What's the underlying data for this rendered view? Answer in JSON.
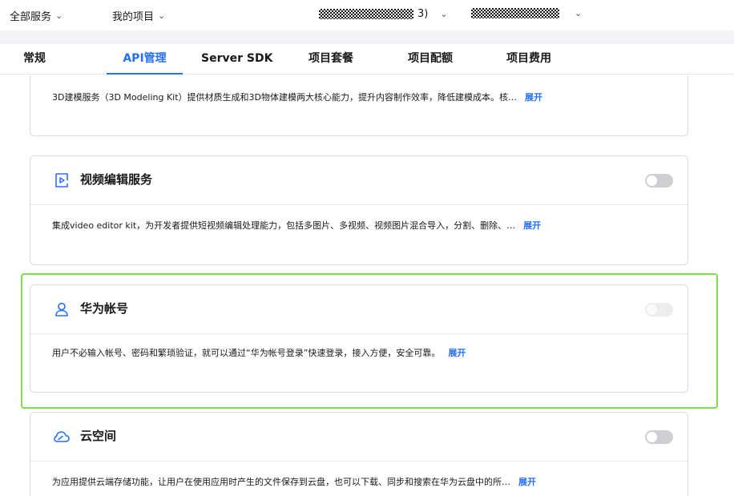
{
  "topbar": {
    "all_services": "全部服务",
    "my_projects": "我的项目",
    "project_suffix": "3)"
  },
  "tabs": [
    {
      "label": "常规"
    },
    {
      "label": "API管理"
    },
    {
      "label": "Server SDK"
    },
    {
      "label": "项目套餐"
    },
    {
      "label": "项目配额"
    },
    {
      "label": "项目费用"
    }
  ],
  "cards": {
    "modeling": {
      "desc": "3D建模服务（3D Modeling Kit）提供材质生成和3D物体建模两大核心能力，提升内容制作效率，降低建模成本。核…",
      "expand": "展开"
    },
    "video": {
      "title": "视频编辑服务",
      "desc": "集成video editor kit，为开发者提供短视频编辑处理能力，包括多图片、多视频、视频图片混合导入，分割、删除、…",
      "expand": "展开",
      "icon": "video-edit-icon"
    },
    "account": {
      "title": "华为帐号",
      "desc": "用户不必输入帐号、密码和繁琐验证，就可以通过“华为帐号登录”快速登录，接入方便，安全可靠。",
      "expand": "展开",
      "icon": "user-icon"
    },
    "cloud": {
      "title": "云空间",
      "desc": "为应用提供云端存储功能，让用户在使用应用时产生的文件保存到云盘，也可以下载、同步和搜索在华为云盘中的所…",
      "expand": "展开",
      "icon": "cloud-icon"
    }
  },
  "colors": {
    "accent": "#256fff",
    "highlight": "#7de04a"
  }
}
